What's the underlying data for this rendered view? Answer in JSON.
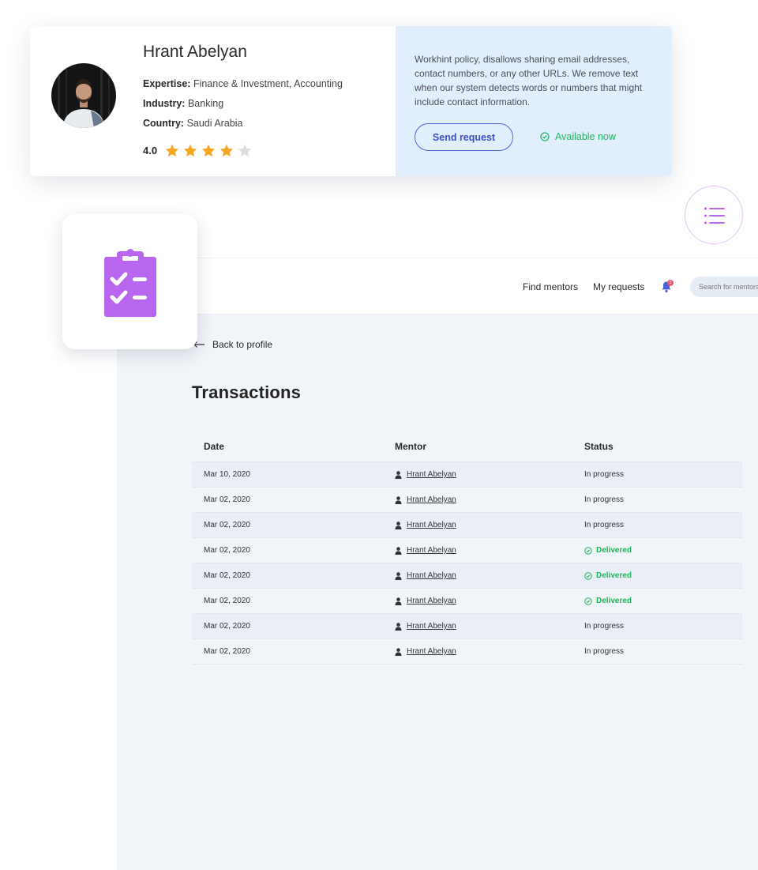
{
  "profile": {
    "name": "Hrant Abelyan",
    "expertise_label": "Expertise:",
    "expertise": "Finance & Investment, Accounting",
    "industry_label": "Industry:",
    "industry": "Banking",
    "country_label": "Country:",
    "country": "Saudi Arabia",
    "rating": "4.0",
    "rating_stars": 4,
    "rating_max": 5,
    "policy": "Workhint policy, disallows sharing email addresses, contact numbers, or any other URLs. We remove text when our system detects words or numbers that might include contact information.",
    "send_request_label": "Send request",
    "availability": "Available now"
  },
  "header": {
    "nav": [
      "Find mentors",
      "My requests"
    ],
    "notification_count": "2",
    "search_placeholder": "Search for mentors"
  },
  "main": {
    "back_label": "Back to profile",
    "title": "Transactions",
    "columns": [
      "Date",
      "Mentor",
      "Status"
    ],
    "rows": [
      {
        "date": "Mar 10, 2020",
        "mentor": "Hrant Abelyan",
        "status": "In progress"
      },
      {
        "date": "Mar 02, 2020",
        "mentor": "Hrant Abelyan",
        "status": "In progress"
      },
      {
        "date": "Mar 02, 2020",
        "mentor": "Hrant Abelyan",
        "status": "In progress"
      },
      {
        "date": "Mar 02, 2020",
        "mentor": "Hrant Abelyan",
        "status": "Delivered"
      },
      {
        "date": "Mar 02, 2020",
        "mentor": "Hrant Abelyan",
        "status": "Delivered"
      },
      {
        "date": "Mar 02, 2020",
        "mentor": "Hrant Abelyan",
        "status": "Delivered"
      },
      {
        "date": "Mar 02, 2020",
        "mentor": "Hrant Abelyan",
        "status": "In progress"
      },
      {
        "date": "Mar 02, 2020",
        "mentor": "Hrant Abelyan",
        "status": "In progress"
      }
    ]
  },
  "icons": {
    "clipboard": "clipboard-check-icon",
    "menu": "list-menu-icon",
    "bell": "bell-icon",
    "person": "person-icon",
    "check": "check-circle-icon",
    "star": "star-icon",
    "back": "arrow-left-icon"
  },
  "colors": {
    "accent_purple": "#b866f0",
    "button_blue": "#5264d9",
    "success_green": "#22b562",
    "star_gold": "#f5a623",
    "star_empty": "#dcdcdc",
    "panel_bg": "#f1f4f8",
    "policy_bg": "#e1eefb"
  }
}
